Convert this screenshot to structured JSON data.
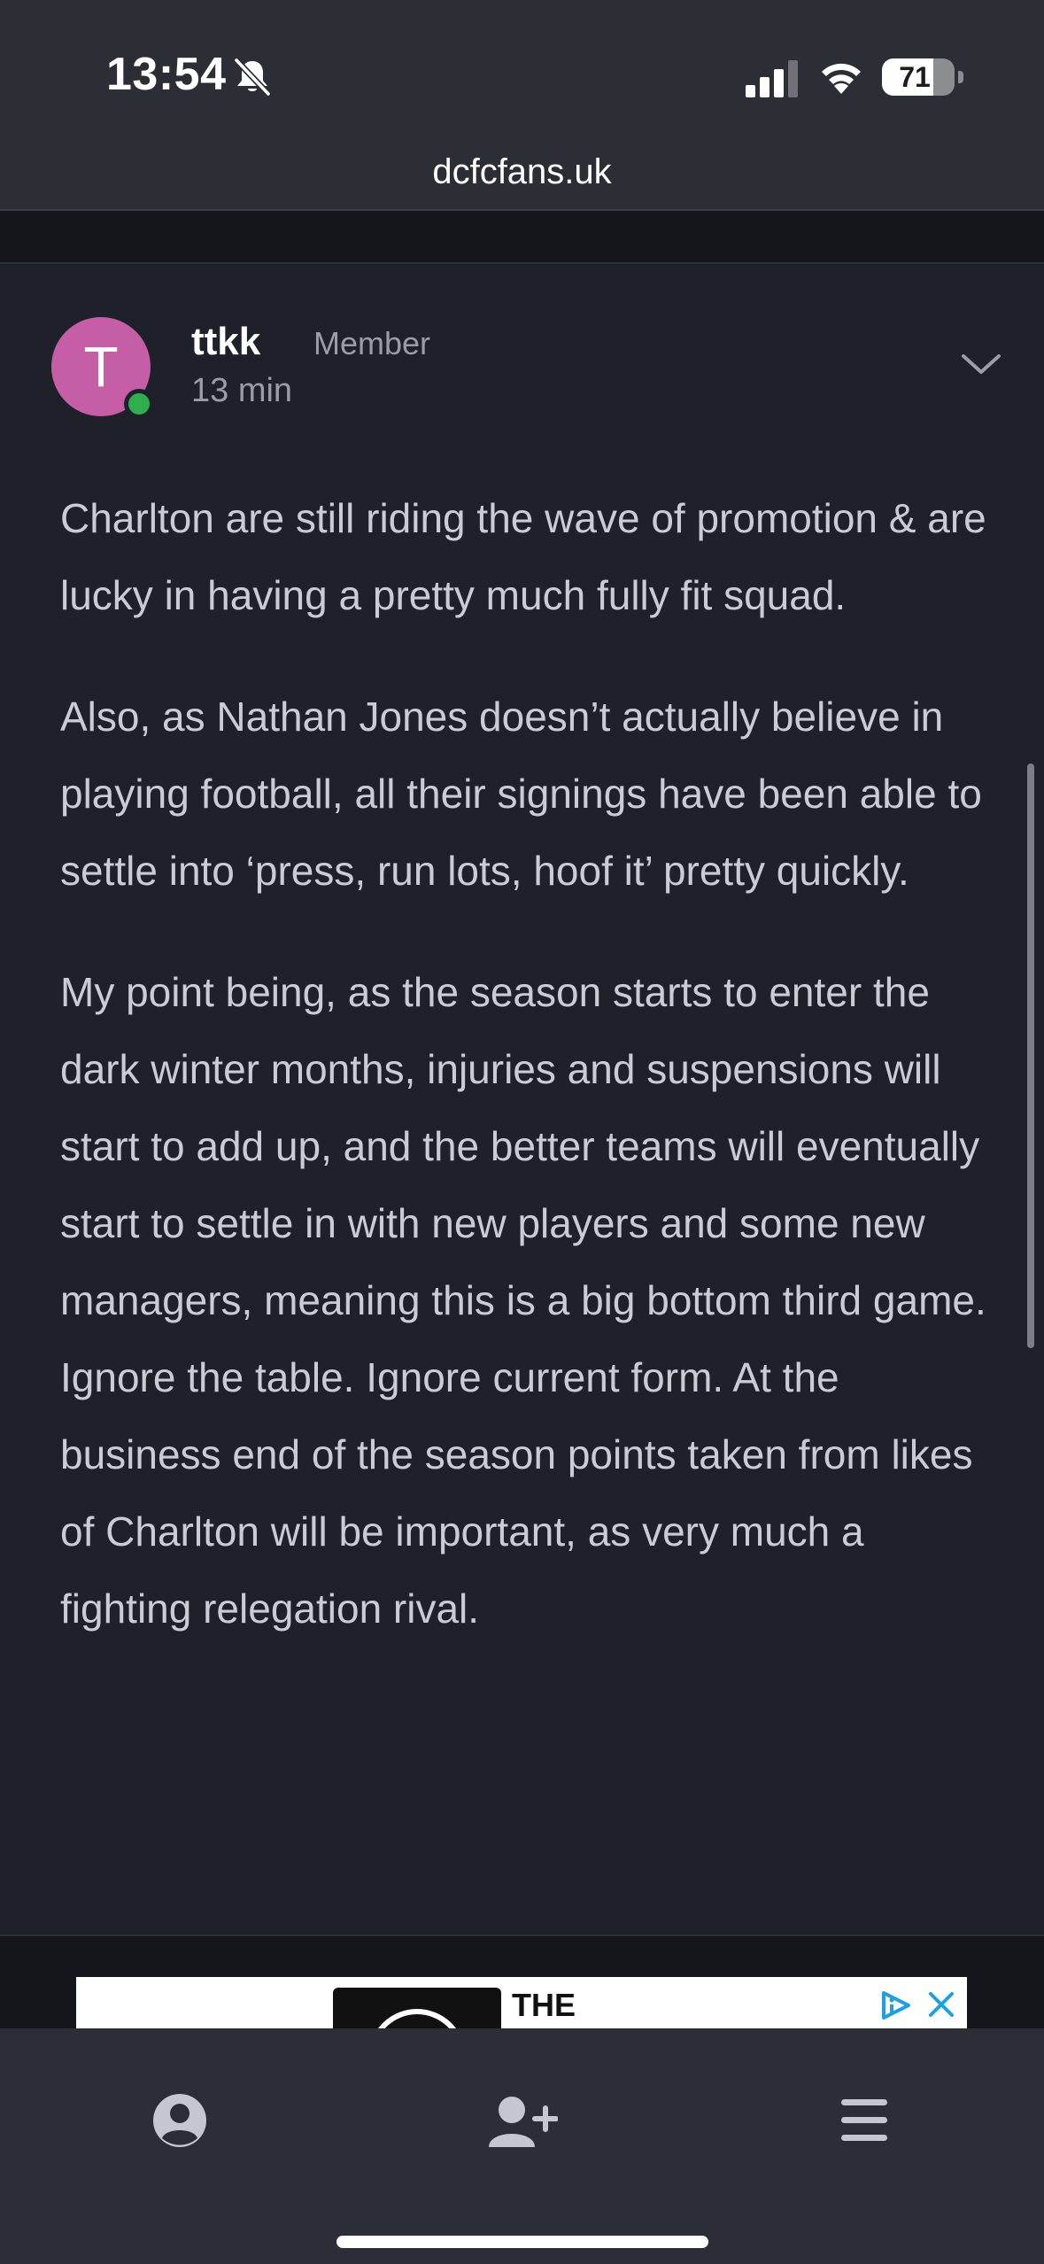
{
  "status_bar": {
    "time": "13:54",
    "battery_percent": "71",
    "battery_level": 0.71,
    "icons": [
      "bell-slash-icon",
      "cellular-signal-icon",
      "wifi-icon",
      "battery-icon"
    ]
  },
  "browser": {
    "url": "dcfcfans.uk"
  },
  "post": {
    "avatar_letter": "T",
    "author": "ttkk",
    "role": "Member",
    "time": "13 min",
    "online": true,
    "paragraphs": [
      "Charlton are still riding the wave of promotion & are lucky in having a pretty much fully fit squad.",
      "Also, as Nathan Jones doesn’t actually believe in playing football, all their signings have been able to settle into ‘press, run lots, hoof it’ pretty quickly.",
      "My point being, as the season starts to enter the dark winter months, injuries and suspensions will start to add up, and the better teams will eventually start to settle in with new players and some new managers, meaning this is a big bottom third game. Ignore the table. Ignore current form. At the business end of the season points taken from likes of Charlton will be important, as very much a fighting relegation rival."
    ]
  },
  "ad": {
    "text": "THE",
    "icons": [
      "adchoices-icon",
      "close-icon"
    ]
  },
  "bottom_nav": {
    "items": [
      "account-icon",
      "add-user-icon",
      "menu-icon"
    ]
  },
  "colors": {
    "background": "#1f212a",
    "text": "#c9ccd3",
    "avatar": "#c65ea7",
    "online": "#2fae4e",
    "ad_blue": "#1ba0e2"
  }
}
